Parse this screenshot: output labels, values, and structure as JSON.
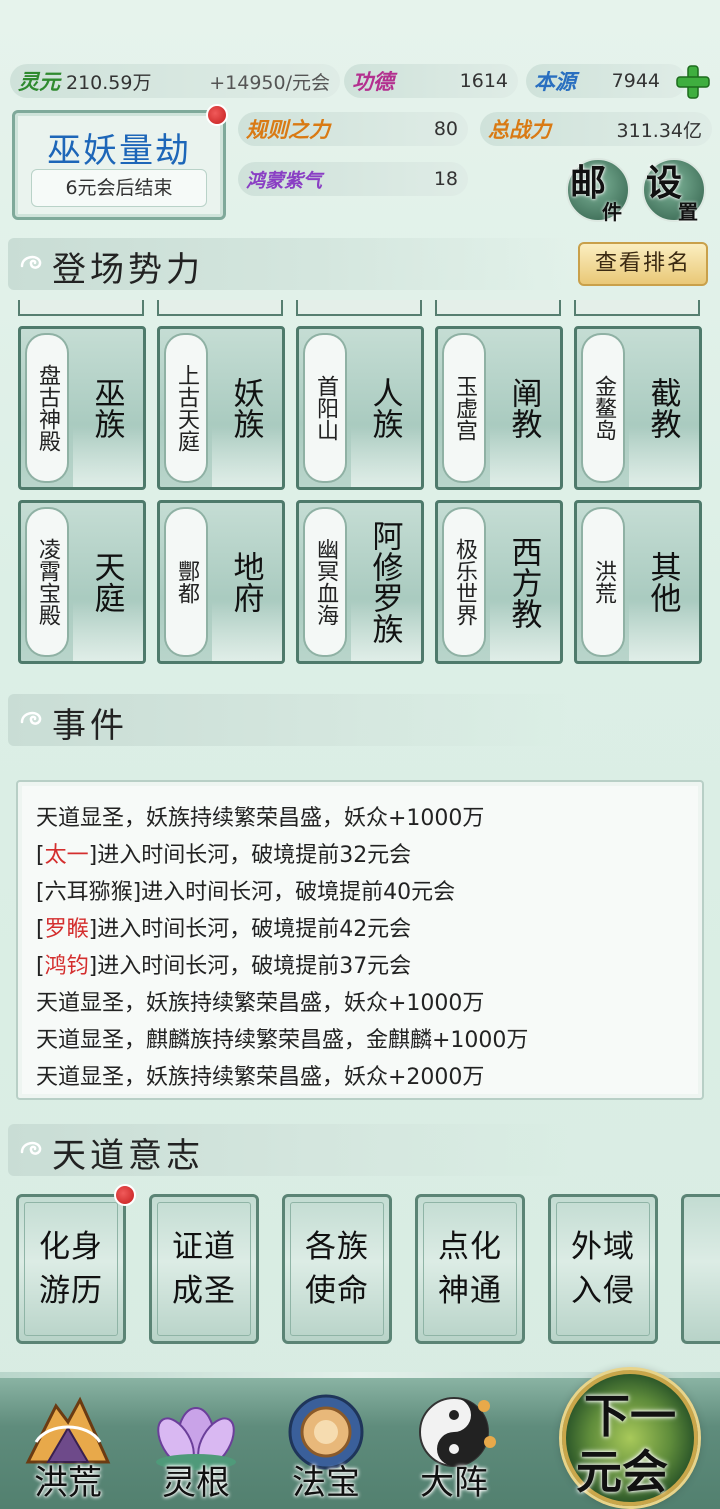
{
  "top_stats": {
    "lingyuan": {
      "label": "灵元",
      "value": "210.59万",
      "rate": "+14950/元会"
    },
    "gongde": {
      "label": "功德",
      "value": "1614"
    },
    "benyuan": {
      "label": "本源",
      "value": "7944"
    },
    "guize": {
      "label": "规则之力",
      "value": "80"
    },
    "zongzhanli": {
      "label": "总战力",
      "value": "311.34亿"
    },
    "hongmeng": {
      "label": "鸿蒙紫气",
      "value": "18"
    }
  },
  "event_card": {
    "title": "巫妖量劫",
    "subtitle": "6元会后结束"
  },
  "buttons": {
    "mail": {
      "big": "邮",
      "small": "件"
    },
    "settings": {
      "big": "设",
      "small": "置"
    },
    "rank": "查看排名"
  },
  "sections": {
    "factions": "登场势力",
    "events": "事件",
    "will": "天道意志"
  },
  "factions": [
    {
      "place": "盘古神殿",
      "name": "巫族"
    },
    {
      "place": "上古天庭",
      "name": "妖族"
    },
    {
      "place": "首阳山",
      "name": "人族"
    },
    {
      "place": "玉虚宫",
      "name": "阐教"
    },
    {
      "place": "金鳌岛",
      "name": "截教"
    },
    {
      "place": "凌霄宝殿",
      "name": "天庭"
    },
    {
      "place": "酆都",
      "name": "地府"
    },
    {
      "place": "幽冥血海",
      "name": "阿修罗族"
    },
    {
      "place": "极乐世界",
      "name": "西方教"
    },
    {
      "place": "洪荒",
      "name": "其他"
    }
  ],
  "event_log": [
    {
      "pre": "",
      "name": "",
      "text": "天道显圣，妖族持续繁荣昌盛，妖众+1000万"
    },
    {
      "pre": "[",
      "name": "太一",
      "text": "]进入时间长河，破境提前32元会"
    },
    {
      "pre": "[六耳猕猴",
      "name": "",
      "text": "]进入时间长河，破境提前40元会"
    },
    {
      "pre": "[",
      "name": "罗睺",
      "text": "]进入时间长河，破境提前42元会"
    },
    {
      "pre": "[",
      "name": "鸿钧",
      "text": "]进入时间长河，破境提前37元会"
    },
    {
      "pre": "",
      "name": "",
      "text": "天道显圣，妖族持续繁荣昌盛，妖众+1000万"
    },
    {
      "pre": "",
      "name": "",
      "text": "天道显圣，麒麟族持续繁荣昌盛，金麒麟+1000万"
    },
    {
      "pre": "",
      "name": "",
      "text": "天道显圣，妖族持续繁荣昌盛，妖众+2000万"
    }
  ],
  "will_cards": [
    {
      "l1": "化身",
      "l2": "游历"
    },
    {
      "l1": "证道",
      "l2": "成圣"
    },
    {
      "l1": "各族",
      "l2": "使命"
    },
    {
      "l1": "点化",
      "l2": "神通"
    },
    {
      "l1": "外域",
      "l2": "入侵"
    }
  ],
  "nav": [
    "洪荒",
    "灵根",
    "法宝",
    "大阵"
  ],
  "next": {
    "l1": "下一",
    "l2": "元会"
  },
  "colors": {
    "accent": "#1d66b8",
    "highlight_name": "#d42e2e",
    "panel_border": "#4e7a6b"
  }
}
